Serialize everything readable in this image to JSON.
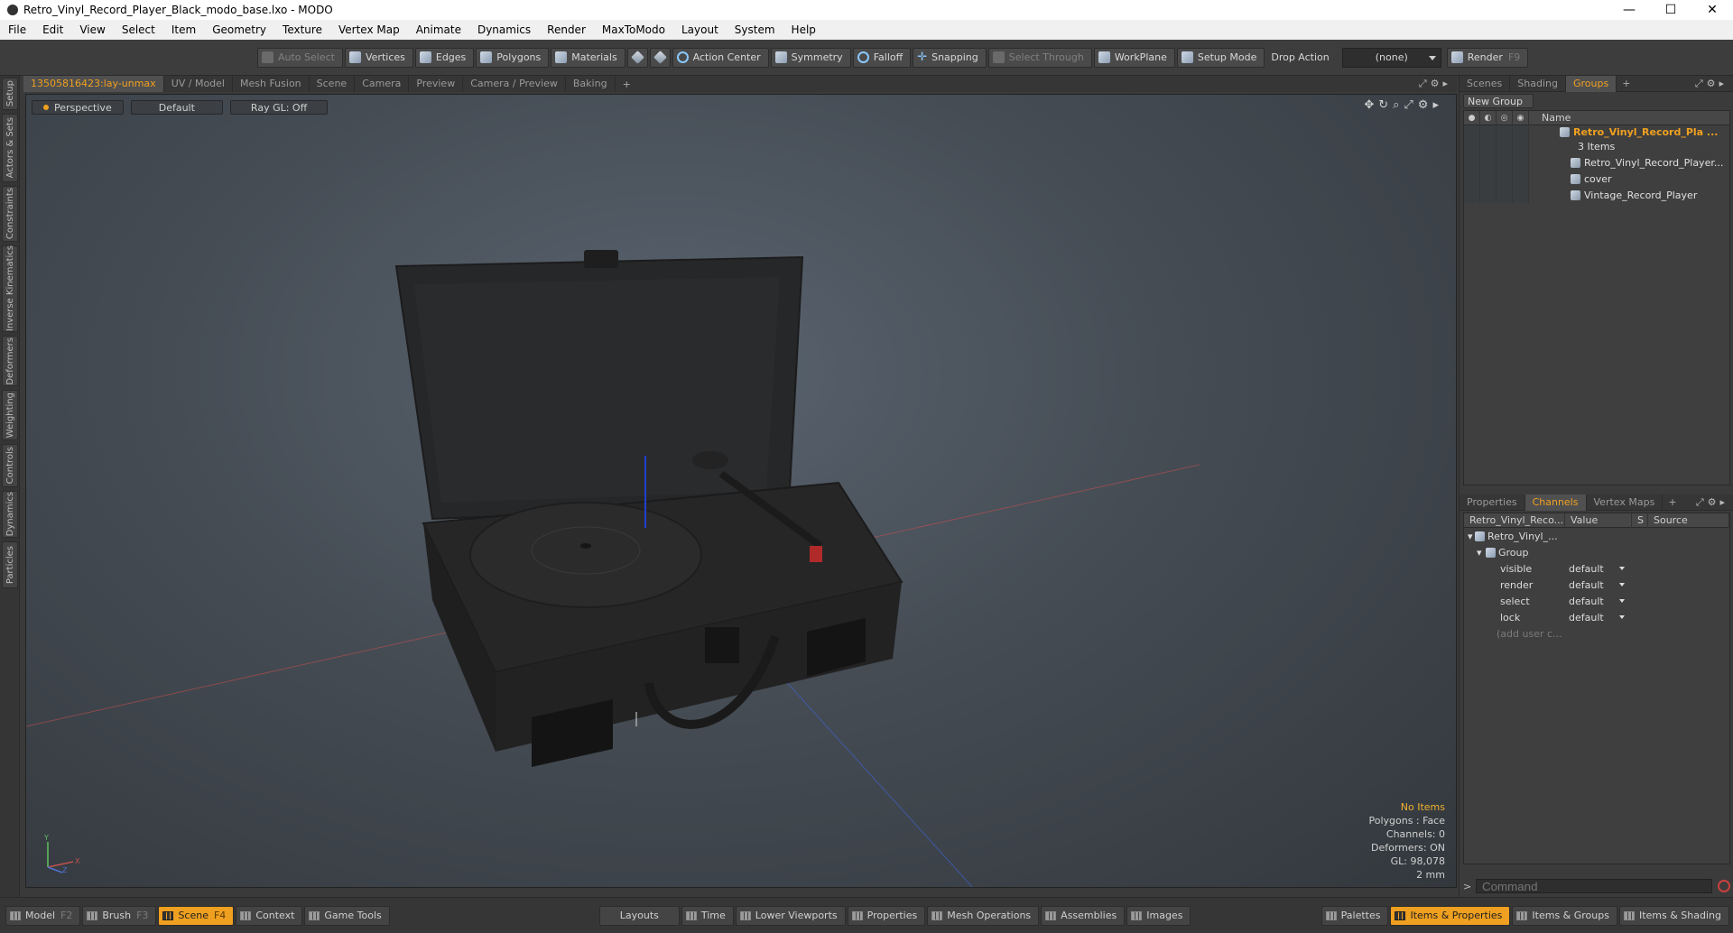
{
  "window": {
    "title": "Retro_Vinyl_Record_Player_Black_modo_base.lxo - MODO",
    "minimize": "—",
    "maximize": "☐",
    "close": "✕"
  },
  "menu": [
    "File",
    "Edit",
    "View",
    "Select",
    "Item",
    "Geometry",
    "Texture",
    "Vertex Map",
    "Animate",
    "Dynamics",
    "Render",
    "MaxToModo",
    "Layout",
    "System",
    "Help"
  ],
  "toolbar": {
    "auto_select": "Auto Select",
    "vertices": "Vertices",
    "edges": "Edges",
    "polygons": "Polygons",
    "materials": "Materials",
    "action_center": "Action Center",
    "symmetry": "Symmetry",
    "falloff": "Falloff",
    "snapping": "Snapping",
    "select_through": "Select Through",
    "workplane": "WorkPlane",
    "setup_mode": "Setup Mode",
    "drop_action": "Drop Action",
    "drop_value": "(none)",
    "render": "Render",
    "render_key": "F9"
  },
  "left_tabs": [
    "Setup",
    "Actors & Sets",
    "Constraints",
    "Inverse Kinematics",
    "Deformers",
    "Weighting",
    "Controls",
    "Dynamics",
    "Particles"
  ],
  "viewport_tabs": {
    "active": "13505816423:lay-unmax",
    "others": [
      "UV / Model",
      "Mesh Fusion",
      "Scene",
      "Camera",
      "Preview",
      "Camera / Preview",
      "Baking"
    ],
    "plus": "+"
  },
  "viewport": {
    "view": "Perspective",
    "shading": "Default",
    "raygl": "Ray GL: Off",
    "info": {
      "items": "No Items",
      "polygons": "Polygons : Face",
      "channels": "Channels: 0",
      "deformers": "Deformers: ON",
      "gl": "GL: 98,078",
      "grid": "2 mm"
    },
    "axis": {
      "x": "X",
      "y": "Y",
      "z": "Z"
    }
  },
  "right_tabs": {
    "items": [
      "Scenes",
      "Shading",
      "Groups"
    ],
    "active": "Groups",
    "plus": "+"
  },
  "groups": {
    "new_group": "New Group",
    "name_header": "Name",
    "group_name": "Retro_Vinyl_Record_Pla ...",
    "item_count": "3 Items",
    "children": [
      "Retro_Vinyl_Record_Player...",
      "cover",
      "Vintage_Record_Player"
    ]
  },
  "lower_tabs": {
    "items": [
      "Properties",
      "Channels",
      "Vertex Maps"
    ],
    "active": "Channels",
    "plus": "+"
  },
  "channels": {
    "headers": [
      "Retro_Vinyl_Reco...",
      "Value",
      "S",
      "Source"
    ],
    "root": "Retro_Vinyl_...",
    "group": "Group",
    "rows": [
      {
        "name": "visible",
        "value": "default"
      },
      {
        "name": "render",
        "value": "default"
      },
      {
        "name": "select",
        "value": "default"
      },
      {
        "name": "lock",
        "value": "default"
      }
    ],
    "add_user": "(add user c..."
  },
  "command": {
    "prompt": ">",
    "placeholder": "Command"
  },
  "bottombar": {
    "model": "Model",
    "model_key": "F2",
    "brush": "Brush",
    "brush_key": "F3",
    "scene": "Scene",
    "scene_key": "F4",
    "context": "Context",
    "game_tools": "Game Tools",
    "layouts": "Layouts",
    "time": "Time",
    "lower_viewports": "Lower Viewports",
    "properties": "Properties",
    "mesh_operations": "Mesh Operations",
    "assemblies": "Assemblies",
    "images": "Images",
    "palettes": "Palettes",
    "items_properties": "Items & Properties",
    "items_groups": "Items & Groups",
    "items_shading": "Items & Shading"
  },
  "colors": {
    "accent": "#f0a020",
    "viewport_bg": "#454c54"
  }
}
